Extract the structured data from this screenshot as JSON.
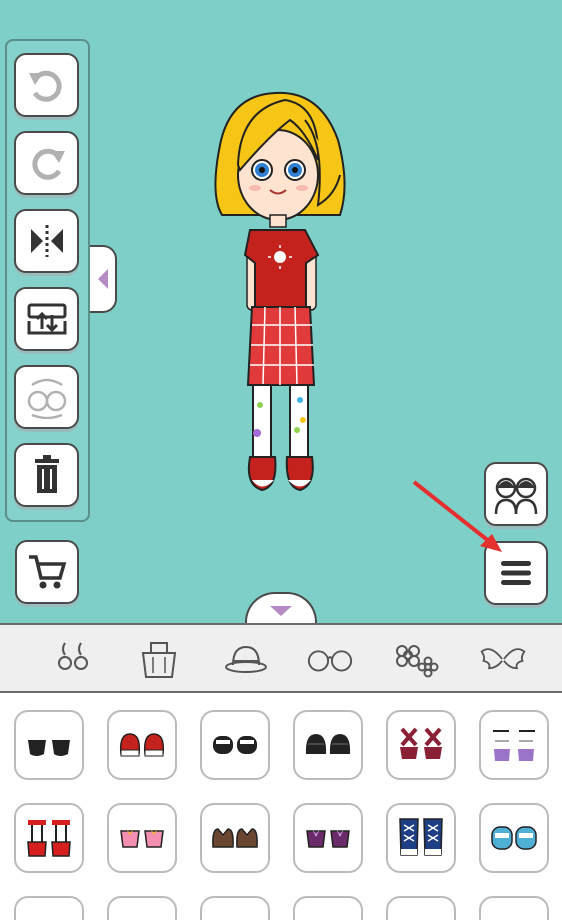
{
  "app": {
    "screen": "dress-up-editor"
  },
  "toolbar": {
    "buttons": [
      {
        "name": "undo",
        "icon": "undo-icon",
        "enabled": false
      },
      {
        "name": "redo",
        "icon": "redo-icon",
        "enabled": false
      },
      {
        "name": "flip",
        "icon": "flip-horizontal-icon",
        "enabled": true
      },
      {
        "name": "layer",
        "icon": "layer-order-icon",
        "enabled": true
      },
      {
        "name": "swap",
        "icon": "swap-characters-icon",
        "enabled": false
      },
      {
        "name": "delete",
        "icon": "trash-icon",
        "enabled": true
      }
    ]
  },
  "actions": {
    "shop_icon": "cart-icon",
    "friends_icon": "characters-icon",
    "menu_icon": "hamburger-menu-icon"
  },
  "categories": [
    {
      "icon": "earrings-icon"
    },
    {
      "icon": "bag-icon"
    },
    {
      "icon": "hat-icon"
    },
    {
      "icon": "glasses-icon"
    },
    {
      "icon": "flowers-icon"
    },
    {
      "icon": "wings-icon"
    }
  ],
  "items": [
    {
      "icon": "black-flats-icon"
    },
    {
      "icon": "red-sneakers-icon"
    },
    {
      "icon": "black-band-shoes-icon"
    },
    {
      "icon": "black-loafers-icon"
    },
    {
      "icon": "red-strap-heels-icon"
    },
    {
      "icon": "purple-boots-icon"
    },
    {
      "icon": "red-boots-icon"
    },
    {
      "icon": "pink-bow-shoes-icon"
    },
    {
      "icon": "brown-shoes-icon"
    },
    {
      "icon": "purple-bow-shoes-icon"
    },
    {
      "icon": "blue-high-tops-icon"
    },
    {
      "icon": "blue-sandals-icon"
    }
  ],
  "colors": {
    "background": "#7ecfc8",
    "accent": "#b58bc6",
    "arrow": "#e53030"
  }
}
